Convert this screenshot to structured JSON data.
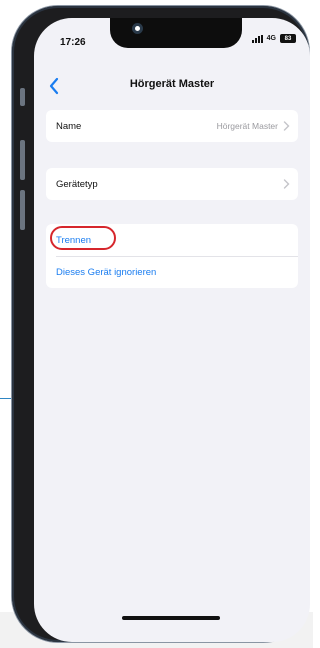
{
  "status_bar": {
    "time": "17:26",
    "network": "4G",
    "battery": "83"
  },
  "nav": {
    "title": "Hörgerät Master"
  },
  "settings": {
    "name_row": {
      "label": "Name",
      "value": "Hörgerät Master"
    },
    "device_type_row": {
      "label": "Gerätetyp"
    },
    "actions": [
      {
        "label": "Trennen"
      },
      {
        "label": "Dieses Gerät ignorieren"
      }
    ]
  },
  "colors": {
    "link": "#1a7df0",
    "highlight": "#d6262c",
    "background": "#f2f2f7",
    "phone_frame": "#1d1d1f"
  },
  "icons": [
    "back-chevron-icon",
    "chevron-right-icon",
    "signal-icon",
    "battery-icon"
  ]
}
